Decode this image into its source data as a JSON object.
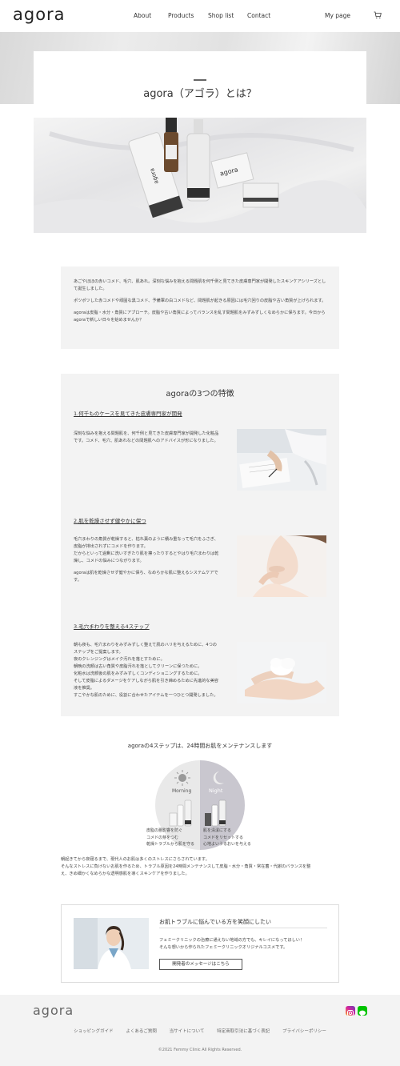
{
  "header": {
    "logo": "agora",
    "nav": [
      "About",
      "Products",
      "Shop list",
      "Contact"
    ],
    "mypage": "My page"
  },
  "hero": {
    "title": "agora（アゴラ）とは？"
  },
  "intro": {
    "paragraphs": [
      "あごやほほの赤いコメド、毛穴、肌あれ。深刻な悩みを抱える問題肌を何千例と見てきた皮膚専門家が開発したスキンケアシリーズとして誕生しました。",
      "ポツポツした赤コメドや頑固な黒コメド、予備軍の白コメドなど、問題肌が起きる原因には毛穴回りの皮脂や古い角質が上げられます。",
      "agoraは皮脂・水分・角質にアプローチ。皮脂や古い角質によってバランスを乱す問題肌をみずみずしくなめらかに保ちます。今日からagoraで新しい日々を始めませんか？"
    ]
  },
  "features": {
    "title": "agoraの3つの特徴",
    "items": [
      {
        "heading": "1.何千ものケースを見てきた皮膚専門家が開発",
        "lines": [
          "深刻な悩みを抱える問題肌を、何千例と見てきた皮膚専門家が開発した化粧品",
          "です。コメド、毛穴、肌あれなどの問題肌へのアドバイスが形になりました。"
        ]
      },
      {
        "heading": "2.肌を乾燥させず健やかに保つ",
        "lines": [
          "毛穴まわりの角質が乾燥すると、枯れ葉のように積み重なって毛穴をふさぎ、",
          "皮脂が排出されずにコメドを作ります。",
          "だからといって過剰に洗いすぎたり肌を擦ったりするとやはり毛穴まわりは乾",
          "燥し、コメドの悩みにつながります。",
          "",
          "agoraは肌を乾燥させず健やかに保ち、なめらかな肌に整えるシステムケアで",
          "す。"
        ]
      },
      {
        "heading": "3.毛穴まわりを整える4ステップ",
        "lines": [
          "朝も夜も、毛穴まわりをみずみずしく整えて肌のハリを与えるために、4つの",
          "ステップをご提案します。",
          "夜のクレンジングはメイク汚れを落とすために。",
          "朝晩の洗顔は古い角質や皮脂汚れを落としてクリーンに保つために。",
          "化粧水は洗顔後の肌をみずみずしくコンディショニングするために。",
          "そして皮脂によるダメージをケアしながら肌を引き締めるために先進的な美容",
          "液を推奨。",
          "すこやかな肌のために、役割に合わせたアイテムを一つひとつ開発しました。"
        ]
      }
    ]
  },
  "maintenance": {
    "title": "agoraの4ステップは、24時間お肌をメンテナンスします",
    "morning_label": "Morning",
    "night_label": "Night",
    "morning_lines": [
      "皮脂の悪影響を防ぐ",
      "コメドの芽をつむ",
      "乾燥トラブルから肌を守る"
    ],
    "night_lines": [
      "肌を清潔にする",
      "コメドをリセットする",
      "心地よいうるおいを与える"
    ],
    "text_lines": [
      "朝起きてから夜寝るまで、現代人のお肌は多くのストレスにさらされています。",
      "そんなストレスに負けないお肌を作るため、トラブル原因を24時間メンテナンスして皮脂・水分・角質・常在菌・代謝のバランスを整",
      "え、きめ細かくなめらかな透明感肌を導くスキンケアを作りました。"
    ]
  },
  "doctor": {
    "title": "お肌トラブルに悩んでいる方を笑顔にしたい",
    "lines": [
      "フェミークリニックの治療に通えない地域の方でも、キレイになってほしい！",
      "そんな想いから作られたフェミークリニックオリジナルコスメです。"
    ],
    "button": "開発者のメッセージはこちら"
  },
  "footer": {
    "logo": "agora",
    "links": [
      "ショッピングガイド",
      "よくあるご質問",
      "当サイトについて",
      "特定商取引法に基づく表記",
      "プライバシーポリシー"
    ],
    "copyright": "©2021 Femmy Clinic All Rights Reserved."
  },
  "colors": {
    "accent": "#333333",
    "panel": "#f3f3f3",
    "line_green": "#00c300",
    "instagram": "#d6249f"
  },
  "icons": [
    "cart-icon",
    "instagram-icon",
    "line-icon",
    "sun-icon",
    "moon-icon"
  ]
}
